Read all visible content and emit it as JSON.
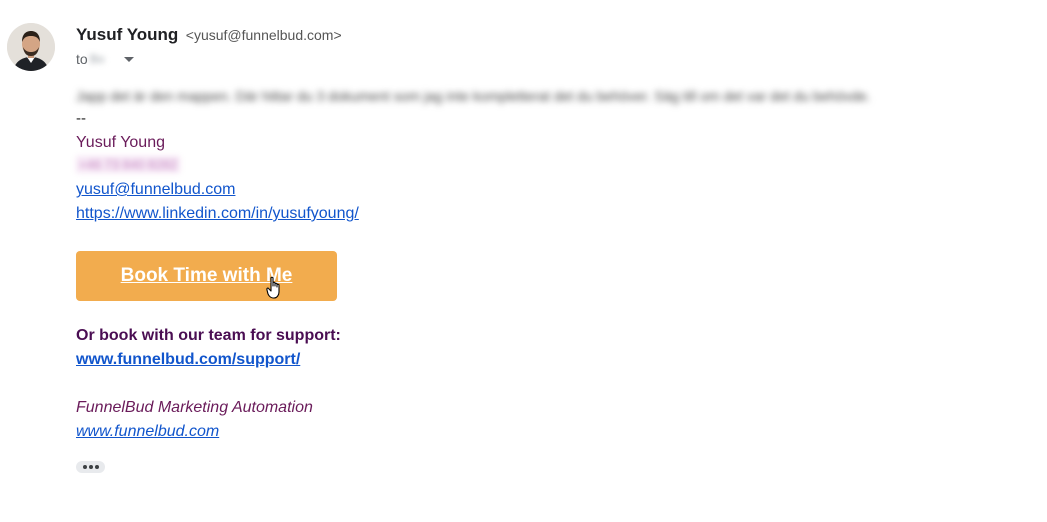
{
  "message": {
    "sender_name": "Yusuf Young",
    "sender_email": "<yusuf@funnelbud.com>",
    "to_label": "to",
    "recipient": "Bo",
    "body": "Japp det är den mappen. Där hittar du 3 dokument som jag inte kompletterat det du behöver. Säg till om det var det du behövde."
  },
  "signature": {
    "separator": "--",
    "name": "Yusuf Young",
    "phone": "+46 73 840 8282",
    "email": "yusuf@funnelbud.com",
    "linkedin": "https://www.linkedin.com/in/yusufyoung/",
    "book_button": "Book Time with Me",
    "support_title": "Or book with our team for support:",
    "support_link": "www.funnelbud.com/support/",
    "company_name": "FunnelBud Marketing Automation",
    "company_link": "www.funnelbud.com"
  },
  "colors": {
    "button_bg": "#f2ac4e",
    "link": "#1155cc",
    "signature_purple": "#6a1b5a"
  },
  "icons": {
    "avatar": "avatar",
    "details": "chevron-down-icon",
    "cursor": "hand-cursor-icon",
    "more": "more-horizontal-icon"
  }
}
